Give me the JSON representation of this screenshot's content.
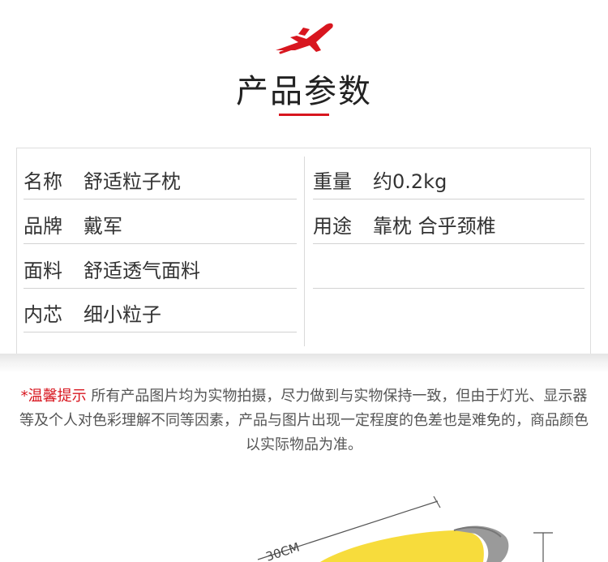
{
  "header": {
    "logo_icon": "red-airplane-icon",
    "title": "产品参数",
    "accent_color": "#d8161f"
  },
  "specs": {
    "left": [
      {
        "label": "名称",
        "value": "舒适粒子枕"
      },
      {
        "label": "品牌",
        "value": "戴军"
      },
      {
        "label": "面料",
        "value": "舒适透气面料"
      },
      {
        "label": "内芯",
        "value": "细小粒子"
      }
    ],
    "right": [
      {
        "label": "重量",
        "value": "约0.2kg"
      },
      {
        "label": "用途",
        "value": "靠枕 合乎颈椎"
      },
      {
        "label": "",
        "value": ""
      }
    ]
  },
  "notice": {
    "warn_label": "*温馨提示",
    "text": " 所有产品图片均为实物拍摄，尽力做到与实物保持一致，但由于灯光、显示器等及个人对色彩理解不同等因素，产品与图片出现一定程度的色差也是难免的，商品颜色以实际物品为准。"
  },
  "product_image": {
    "dimension_label": "30CM",
    "main_color": "#f7dc3c"
  }
}
